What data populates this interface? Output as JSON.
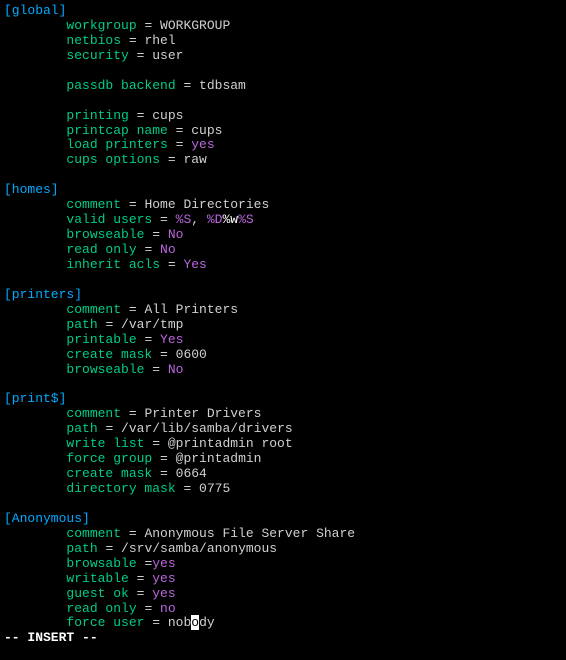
{
  "sections": {
    "global": {
      "header": "[global]",
      "workgroup_key": "workgroup",
      "workgroup_val": "WORKGROUP",
      "netbios_key": "netbios",
      "netbios_val": "rhel",
      "security_key": "security",
      "security_val": "user",
      "passdb_key": "passdb backend",
      "passdb_val": "tdbsam",
      "printing_key": "printing",
      "printing_val": "cups",
      "printcap_key": "printcap name",
      "printcap_val": "cups",
      "loadprinters_key": "load printers",
      "loadprinters_val": "yes",
      "cupsoptions_key": "cups options",
      "cupsoptions_val": "raw"
    },
    "homes": {
      "header": "[homes]",
      "comment_key": "comment",
      "comment_val": "Home Directories",
      "validusers_key": "valid users",
      "validusers_s": "%S",
      "validusers_sep": ", ",
      "validusers_d": "%D",
      "validusers_w": "%w",
      "validusers_s2": "%S",
      "browseable_key": "browseable",
      "browseable_val": "No",
      "readonly_key": "read only",
      "readonly_val": "No",
      "inheritacls_key": "inherit acls",
      "inheritacls_val": "Yes"
    },
    "printers": {
      "header": "[printers]",
      "comment_key": "comment",
      "comment_val": "All Printers",
      "path_key": "path",
      "path_val": "/var/tmp",
      "printable_key": "printable",
      "printable_val": "Yes",
      "createmask_key": "create mask",
      "createmask_val": "0600",
      "browseable_key": "browseable",
      "browseable_val": "No"
    },
    "printdollar": {
      "header": "[print$]",
      "comment_key": "comment",
      "comment_val": "Printer Drivers",
      "path_key": "path",
      "path_val": "/var/lib/samba/drivers",
      "writelist_key": "write list",
      "writelist_val": "@printadmin root",
      "forcegroup_key": "force group",
      "forcegroup_val": "@printadmin",
      "createmask_key": "create mask",
      "createmask_val": "0664",
      "directorymask_key": "directory mask",
      "directorymask_val": "0775"
    },
    "anonymous": {
      "header": "[Anonymous]",
      "comment_key": "comment",
      "comment_val": "Anonymous File Server Share",
      "path_key": "path",
      "path_val": "/srv/samba/anonymous",
      "browsable_key": "browsable",
      "browsable_val": "yes",
      "writable_key": "writable",
      "writable_val": "yes",
      "guestok_key": "guest ok",
      "guestok_val": "yes",
      "readonly_key": "read only",
      "readonly_val": "no",
      "forceuser_key": "force user",
      "forceuser_pre": "nob",
      "forceuser_cur": "o",
      "forceuser_post": "dy"
    }
  },
  "eq": " = ",
  "eq_nospace": " =",
  "status": "-- INSERT --"
}
